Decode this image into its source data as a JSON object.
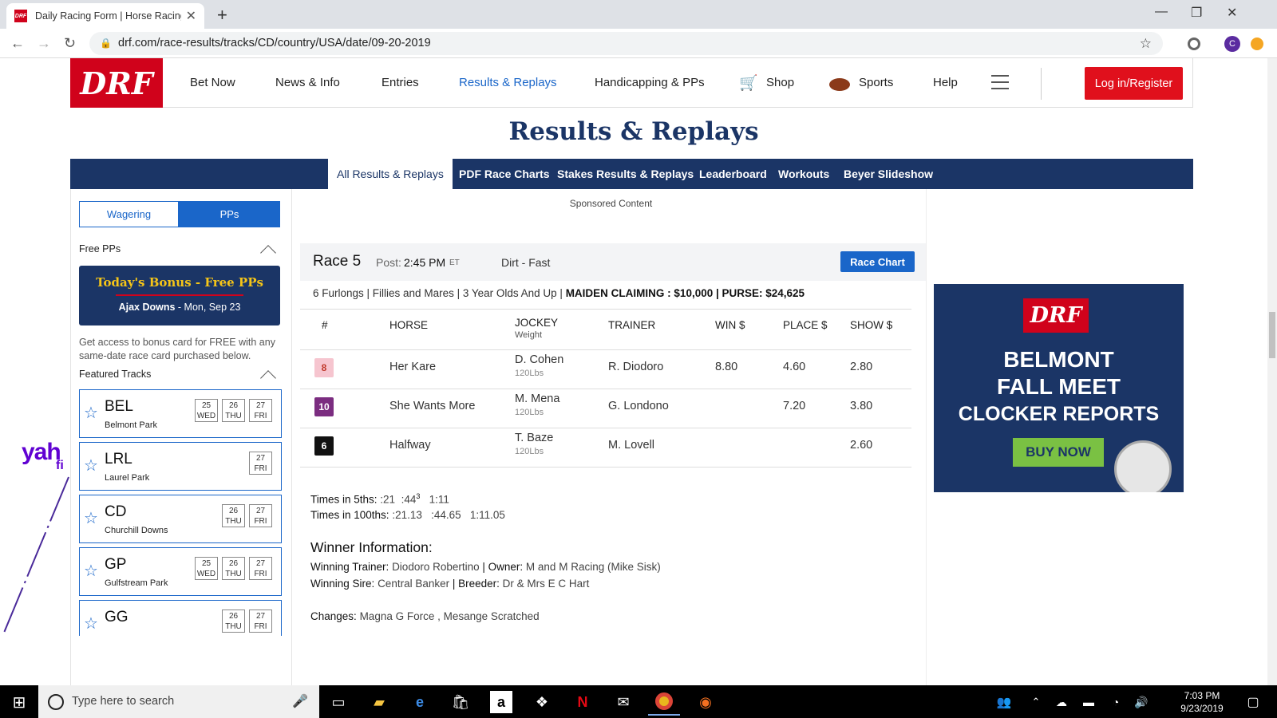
{
  "browser": {
    "tab_title": "Daily Racing Form | Horse Racing",
    "tab_favicon": "DRF",
    "url": "drf.com/race-results/tracks/CD/country/USA/date/09-20-2019",
    "profile_initial": "C"
  },
  "header": {
    "logo": "DRF",
    "nav": [
      "Bet Now",
      "News & Info",
      "Entries",
      "Results & Replays",
      "Handicapping & PPs",
      "Shop",
      "Sports",
      "Help"
    ],
    "active_nav": "Results & Replays",
    "login": "Log in/Register"
  },
  "page_title": "Results & Replays",
  "subnav": [
    "All Results & Replays",
    "PDF Race Charts",
    "Stakes Results & Replays",
    "Leaderboard",
    "Workouts",
    "Beyer Slideshow"
  ],
  "sidebar": {
    "toggle": [
      "Wagering",
      "PPs"
    ],
    "free_pps_label": "Free PPs",
    "bonus_title": "Today's Bonus - Free PPs",
    "bonus_track": "Ajax Downs",
    "bonus_date": " - Mon, Sep 23",
    "bonus_desc": "Get access to bonus card for FREE with any same-date race card purchased below.",
    "featured_label": "Featured Tracks",
    "tracks": [
      {
        "code": "BEL",
        "name": "Belmont Park",
        "days": [
          [
            "25",
            "WED"
          ],
          [
            "26",
            "THU"
          ],
          [
            "27",
            "FRI"
          ]
        ]
      },
      {
        "code": "LRL",
        "name": "Laurel Park",
        "days": [
          [
            "27",
            "FRI"
          ]
        ]
      },
      {
        "code": "CD",
        "name": "Churchill Downs",
        "days": [
          [
            "26",
            "THU"
          ],
          [
            "27",
            "FRI"
          ]
        ]
      },
      {
        "code": "GP",
        "name": "Gulfstream Park",
        "days": [
          [
            "25",
            "WED"
          ],
          [
            "26",
            "THU"
          ],
          [
            "27",
            "FRI"
          ]
        ]
      },
      {
        "code": "GG",
        "name": "",
        "days": [
          [
            "26",
            "THU"
          ],
          [
            "27",
            "FRI"
          ]
        ]
      }
    ]
  },
  "ad_fragment": {
    "text": "yah",
    "sub": "fi"
  },
  "race": {
    "sponsored": "Sponsored Content",
    "title": "Race 5",
    "post_label": "Post:",
    "post_time": "2:45 PM",
    "post_tz": "ET",
    "surface": "Dirt - Fast",
    "chart_button": "Race Chart",
    "conditions": "6 Furlongs | Fillies and Mares | 3 Year Olds And Up | ",
    "conditions_bold": "MAIDEN CLAIMING : $10,000 | PURSE: $24,625",
    "columns": {
      "num": "#",
      "horse": "HORSE",
      "jockey": "JOCKEY",
      "weight": "Weight",
      "trainer": "TRAINER",
      "win": "WIN $",
      "place": "PLACE $",
      "show": "SHOW $"
    },
    "rows": [
      {
        "pgm": "8",
        "pgm_bg": "#f6c5cf",
        "pgm_fg": "#c0392b",
        "horse": "Her Kare",
        "jockey": "D. Cohen",
        "weight": "120Lbs",
        "trainer": "R. Diodoro",
        "win": "8.80",
        "place": "4.60",
        "show": "2.80"
      },
      {
        "pgm": "10",
        "pgm_bg": "#7b2d80",
        "pgm_fg": "#ffffff",
        "horse": "She Wants More",
        "jockey": "M. Mena",
        "weight": "120Lbs",
        "trainer": "G. Londono",
        "win": "",
        "place": "7.20",
        "show": "3.80"
      },
      {
        "pgm": "6",
        "pgm_bg": "#111111",
        "pgm_fg": "#ffffff",
        "horse": "Halfway",
        "jockey": "T. Baze",
        "weight": "120Lbs",
        "trainer": "M. Lovell",
        "win": "",
        "place": "",
        "show": "2.60"
      }
    ],
    "times5_label": "Times in 5ths:",
    "times5": [
      ":21",
      ":44",
      "1:11"
    ],
    "times5_sup": "3",
    "times100_label": "Times in 100ths:",
    "times100": ":21.13   :44.65   1:11.05",
    "winner_heading": "Winner Information:",
    "winning_trainer_label": "Winning Trainer:",
    "winning_trainer": "Diodoro Robertino",
    "owner_label": "Owner:",
    "owner": "M and M Racing (Mike Sisk)",
    "sire_label": "Winning Sire:",
    "sire": "Central Banker",
    "breeder_label": "Breeder:",
    "breeder": "Dr & Mrs E C Hart",
    "changes_label": "Changes:",
    "changes": "Magna G Force , Mesange Scratched"
  },
  "ad": {
    "logo": "DRF",
    "lines": [
      "BELMONT",
      "FALL MEET",
      "CLOCKER REPORTS"
    ],
    "cta": "BUY NOW"
  },
  "taskbar": {
    "search_placeholder": "Type here to search",
    "time": "7:03 PM",
    "date": "9/23/2019"
  },
  "colors": {
    "brand_red": "#d0021b",
    "navy": "#1b3566",
    "link_blue": "#1a66c9",
    "bonus_gold": "#f5c518",
    "ad_green": "#7ac143"
  }
}
